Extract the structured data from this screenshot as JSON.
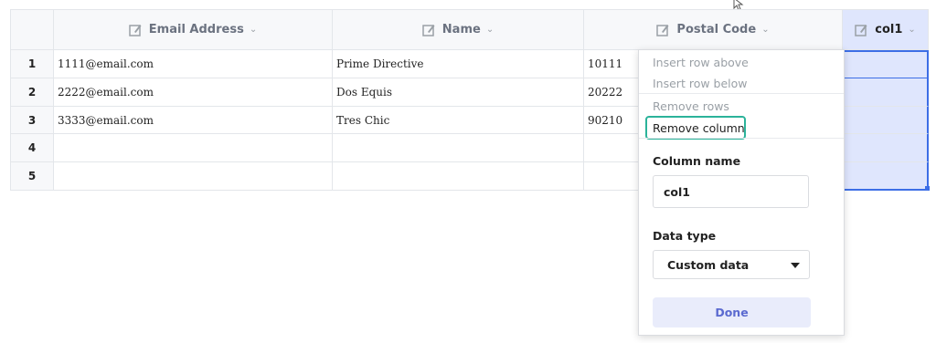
{
  "columns": [
    {
      "label": "Email Address",
      "icon": "edit-table-icon"
    },
    {
      "label": "Name",
      "icon": "edit-table-icon"
    },
    {
      "label": "Postal Code",
      "icon": "edit-table-icon"
    },
    {
      "label": "col1",
      "icon": "edit-table-icon"
    }
  ],
  "rows": [
    {
      "num": "1",
      "email": "1111@email.com",
      "name": "Prime Directive",
      "postal": "10111"
    },
    {
      "num": "2",
      "email": "2222@email.com",
      "name": "Dos Equis",
      "postal": "20222"
    },
    {
      "num": "3",
      "email": "3333@email.com",
      "name": "Tres Chic",
      "postal": "90210"
    },
    {
      "num": "4",
      "email": "",
      "name": "",
      "postal": ""
    },
    {
      "num": "5",
      "email": "",
      "name": "",
      "postal": ""
    }
  ],
  "menu": {
    "insert_above": "Insert row above",
    "insert_below": "Insert row below",
    "remove_rows": "Remove rows",
    "remove_column": "Remove column",
    "column_name_label": "Column name",
    "column_name_value": "col1",
    "data_type_label": "Data type",
    "data_type_value": "Custom data",
    "done": "Done"
  },
  "colors": {
    "accent": "#2bb39a",
    "selected": "#dfe6fd",
    "done_text": "#5b6ad0"
  }
}
